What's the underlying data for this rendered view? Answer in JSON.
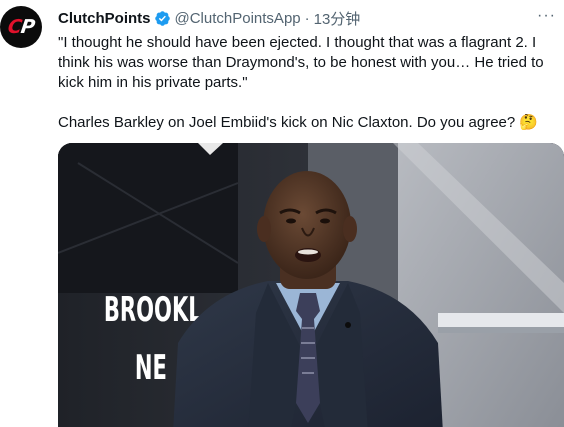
{
  "author": {
    "avatar_letters": "CP",
    "display_name": "ClutchPoints",
    "handle": "@ClutchPointsApp",
    "separator": "·",
    "time": "13分钟"
  },
  "menu_icon": "more-dots-icon",
  "tweet": {
    "quote": "\"I thought he should have been ejected. I thought that was a flagrant 2. I think his was worse than Draymond's, to be honest with you… He tried to kick him in his private parts.\"",
    "caption": "Charles Barkley on Joel Embiid's kick on Nic Claxton. Do you agree?",
    "caption_emoji": "🤔"
  },
  "media": {
    "sign_line1": "BROOKL",
    "sign_line2": "NE"
  },
  "colors": {
    "text": "#0f1419",
    "secondary": "#536471",
    "verified": "#1d9bf0",
    "brand_red": "#e0112b"
  }
}
